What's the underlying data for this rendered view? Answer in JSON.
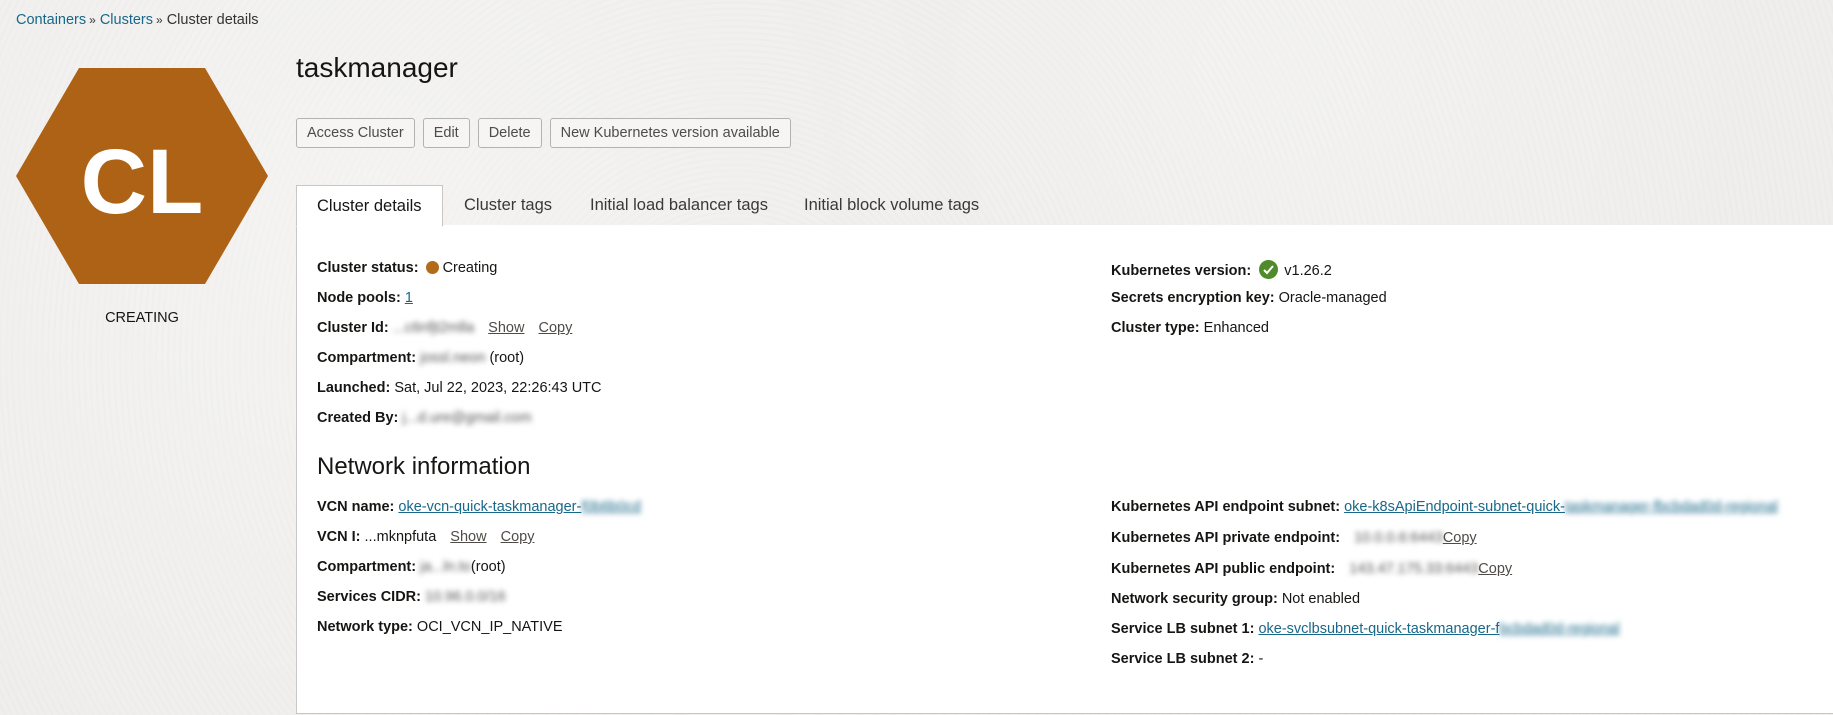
{
  "breadcrumb": {
    "items": [
      "Containers",
      "Clusters"
    ],
    "current": "Cluster details",
    "separator": "»"
  },
  "badge": {
    "initials": "CL",
    "status": "CREATING",
    "color": "#AD6215"
  },
  "cluster_name": "taskmanager",
  "actions": [
    "Access Cluster",
    "Edit",
    "Delete",
    "New Kubernetes version available"
  ],
  "tabs": [
    "Cluster details",
    "Cluster tags",
    "Initial load balancer tags",
    "Initial block volume tags"
  ],
  "details_left": {
    "cluster_status_label": "Cluster status:",
    "cluster_status_value": "Creating",
    "node_pools_label": "Node pools:",
    "node_pools_value": "1",
    "cluster_id_label": "Cluster Id:",
    "cluster_id_value": "...c6nfjt2mlla",
    "show": "Show",
    "copy": "Copy",
    "compartment_label": "Compartment:",
    "compartment_value": "jossl.neon",
    "compartment_suffix": "(root)",
    "launched_label": "Launched:",
    "launched_value": "Sat, Jul 22, 2023, 22:26:43 UTC",
    "created_by_label": "Created By:",
    "created_by_value": "j...d.ure@gmail.com"
  },
  "details_right": {
    "k8s_version_label": "Kubernetes version:",
    "k8s_version_value": "v1.26.2",
    "secrets_label": "Secrets encryption key:",
    "secrets_value": "Oracle-managed",
    "cluster_type_label": "Cluster type:",
    "cluster_type_value": "Enhanced"
  },
  "network": {
    "title": "Network information",
    "vcn_name_label": "VCN name:",
    "vcn_name_value": "oke-vcn-quick-taskmanager-",
    "vcn_name_hidden": "f0b6b0cd",
    "vcn_id_label": "VCN I:",
    "vcn_id_value": "...mknpfuta",
    "show": "Show",
    "copy": "Copy",
    "compartment_label": "Compartment:",
    "compartment_value": "ja...ln.to",
    "compartment_suffix": "(root)",
    "services_cidr_label": "Services CIDR:",
    "services_cidr_value": "10.96.0.0/16",
    "network_type_label": "Network type:",
    "network_type_value": "OCI_VCN_IP_NATIVE",
    "api_subnet_label": "Kubernetes API endpoint subnet:",
    "api_subnet_value": "oke-k8sApiEndpoint-subnet-quick-",
    "api_subnet_hidden": "taskmanager-fbcbdad0d-regional",
    "private_ep_label": "Kubernetes API private endpoint:",
    "private_ep_value": "10.0.0.6:6443",
    "public_ep_label": "Kubernetes API public endpoint:",
    "public_ep_value": "143.47.175.33:6443",
    "nsg_label": "Network security group:",
    "nsg_value": "Not enabled",
    "lb1_label": "Service LB subnet 1:",
    "lb1_value": "oke-svclbsubnet-quick-taskmanager-f",
    "lb1_hidden": "bcbdad0d-regional",
    "lb2_label": "Service LB subnet 2:",
    "lb2_value": "-"
  }
}
